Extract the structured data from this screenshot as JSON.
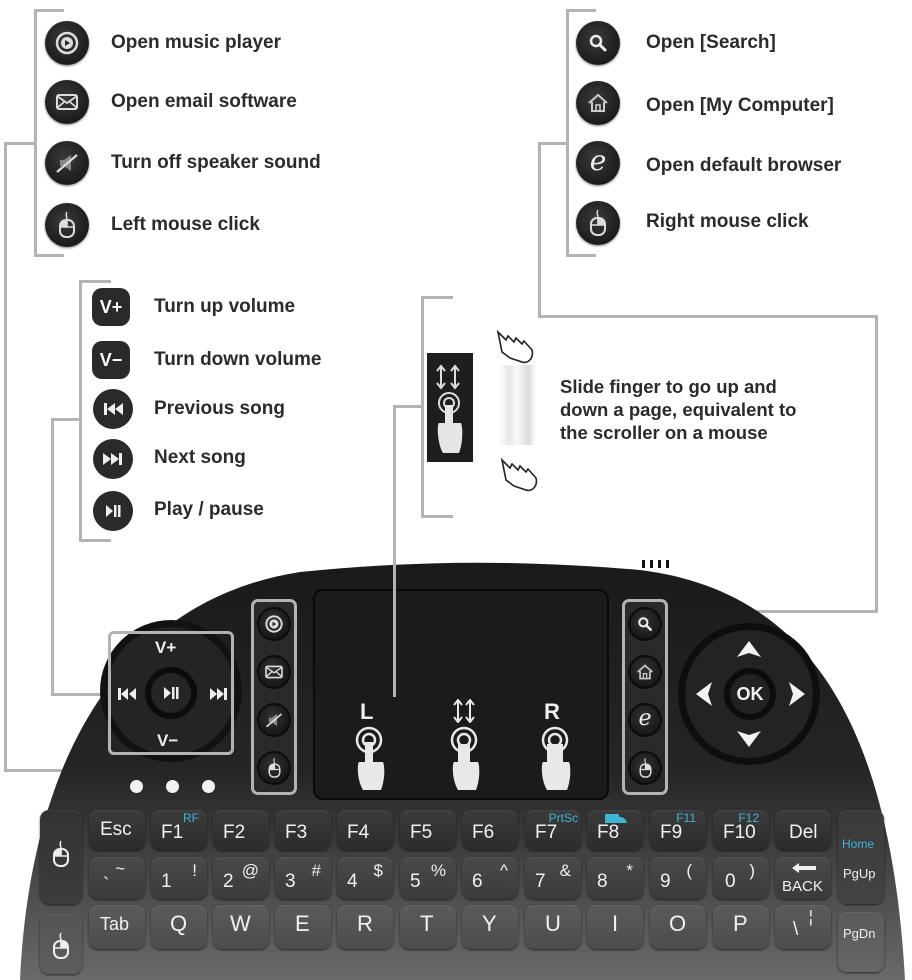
{
  "legend_top_left": {
    "items": [
      {
        "icon": "music-player-icon",
        "label": "Open music player"
      },
      {
        "icon": "email-icon",
        "label": "Open email software"
      },
      {
        "icon": "mute-icon",
        "label": "Turn off speaker sound"
      },
      {
        "icon": "mouse-left-icon",
        "label": "Left mouse click"
      }
    ]
  },
  "legend_top_right": {
    "items": [
      {
        "icon": "search-icon",
        "label": "Open [Search]"
      },
      {
        "icon": "home-icon",
        "label": "Open [My Computer]"
      },
      {
        "icon": "browser-icon",
        "label": "Open default browser",
        "glyph": "e"
      },
      {
        "icon": "mouse-right-icon",
        "label": "Right mouse click"
      }
    ]
  },
  "legend_media": {
    "items": [
      {
        "icon": "volume-up-icon",
        "glyph": "V+",
        "label": "Turn up volume"
      },
      {
        "icon": "volume-down-icon",
        "glyph": "V−",
        "label": "Turn down volume"
      },
      {
        "icon": "previous-song-icon",
        "label": "Previous song"
      },
      {
        "icon": "next-song-icon",
        "label": "Next song"
      },
      {
        "icon": "play-pause-icon",
        "label": "Play / pause"
      }
    ]
  },
  "scroll_note": {
    "lines": [
      "Slide finger to go up and",
      "down a page, equivalent to",
      "the scroller on a mouse"
    ]
  },
  "media_dial": {
    "vol_up": "V+",
    "vol_down": "V−"
  },
  "touchpad": {
    "left_label": "L",
    "right_label": "R"
  },
  "dpad": {
    "ok_label": "OK"
  },
  "keyboard": {
    "row1": [
      {
        "main": "Esc"
      },
      {
        "main": "F1",
        "fn": "RF"
      },
      {
        "main": "F2"
      },
      {
        "main": "F3"
      },
      {
        "main": "F4"
      },
      {
        "main": "F5"
      },
      {
        "main": "F6"
      },
      {
        "main": "F7",
        "fn": "PrtSc"
      },
      {
        "main": "F8",
        "fn_icon": "screen-icon"
      },
      {
        "main": "F9",
        "fn": "F11"
      },
      {
        "main": "F10",
        "fn": "F12"
      },
      {
        "main": "Del"
      }
    ],
    "row2": [
      {
        "main": "`",
        "shift": "~"
      },
      {
        "main": "1",
        "shift": "!"
      },
      {
        "main": "2",
        "shift": "@"
      },
      {
        "main": "3",
        "shift": "#"
      },
      {
        "main": "4",
        "shift": "$"
      },
      {
        "main": "5",
        "shift": "%"
      },
      {
        "main": "6",
        "shift": "^"
      },
      {
        "main": "7",
        "shift": "&"
      },
      {
        "main": "8",
        "shift": "*"
      },
      {
        "main": "9",
        "shift": "("
      },
      {
        "main": "0",
        "shift": ")"
      },
      {
        "main": "BACK",
        "arrow": "←"
      }
    ],
    "row3": [
      {
        "main": "Tab"
      },
      {
        "main": "Q"
      },
      {
        "main": "W"
      },
      {
        "main": "E"
      },
      {
        "main": "R"
      },
      {
        "main": "T"
      },
      {
        "main": "Y"
      },
      {
        "main": "U"
      },
      {
        "main": "I"
      },
      {
        "main": "O"
      },
      {
        "main": "P"
      },
      {
        "main": "\\",
        "shift": "¦"
      }
    ],
    "right_col": {
      "home_fn": "Home",
      "pgup": "PgUp",
      "pgdn": "PgDn"
    }
  },
  "colors": {
    "accent_fn": "#3fb6d6",
    "connector": "#b3b3b3",
    "body": "#1a1a1a"
  }
}
